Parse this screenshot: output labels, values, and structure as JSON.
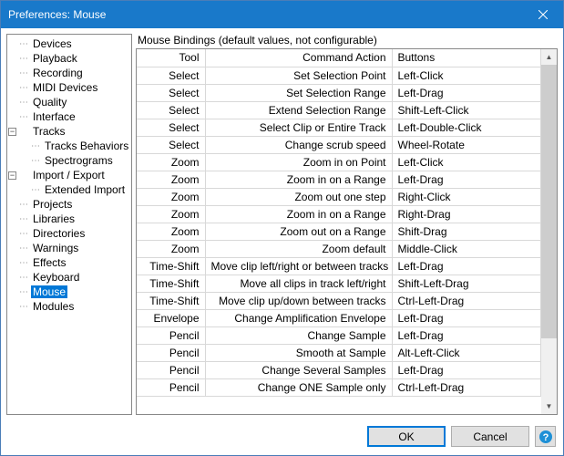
{
  "title": "Preferences: Mouse",
  "group_label": "Mouse Bindings (default values, not configurable)",
  "tree": [
    {
      "label": "Devices",
      "indent": 1,
      "glyph": "dots"
    },
    {
      "label": "Playback",
      "indent": 1,
      "glyph": "dots"
    },
    {
      "label": "Recording",
      "indent": 1,
      "glyph": "dots"
    },
    {
      "label": "MIDI Devices",
      "indent": 1,
      "glyph": "dots"
    },
    {
      "label": "Quality",
      "indent": 1,
      "glyph": "dots"
    },
    {
      "label": "Interface",
      "indent": 1,
      "glyph": "dots"
    },
    {
      "label": "Tracks",
      "indent": 0,
      "glyph": "minus"
    },
    {
      "label": "Tracks Behaviors",
      "indent": 2,
      "glyph": "dots"
    },
    {
      "label": "Spectrograms",
      "indent": 2,
      "glyph": "dots"
    },
    {
      "label": "Import / Export",
      "indent": 0,
      "glyph": "minus"
    },
    {
      "label": "Extended Import",
      "indent": 2,
      "glyph": "dots"
    },
    {
      "label": "Projects",
      "indent": 1,
      "glyph": "dots"
    },
    {
      "label": "Libraries",
      "indent": 1,
      "glyph": "dots"
    },
    {
      "label": "Directories",
      "indent": 1,
      "glyph": "dots"
    },
    {
      "label": "Warnings",
      "indent": 1,
      "glyph": "dots"
    },
    {
      "label": "Effects",
      "indent": 1,
      "glyph": "dots"
    },
    {
      "label": "Keyboard",
      "indent": 1,
      "glyph": "dots"
    },
    {
      "label": "Mouse",
      "indent": 1,
      "glyph": "dots",
      "selected": true
    },
    {
      "label": "Modules",
      "indent": 1,
      "glyph": "dots"
    }
  ],
  "columns": [
    "Tool",
    "Command Action",
    "Buttons"
  ],
  "rows": [
    [
      "Select",
      "Set Selection Point",
      "Left-Click"
    ],
    [
      "Select",
      "Set Selection Range",
      "Left-Drag"
    ],
    [
      "Select",
      "Extend Selection Range",
      "Shift-Left-Click"
    ],
    [
      "Select",
      "Select Clip or Entire Track",
      "Left-Double-Click"
    ],
    [
      "Select",
      "Change scrub speed",
      "Wheel-Rotate"
    ],
    [
      "Zoom",
      "Zoom in on Point",
      "Left-Click"
    ],
    [
      "Zoom",
      "Zoom in on a Range",
      "Left-Drag"
    ],
    [
      "Zoom",
      "Zoom out one step",
      "Right-Click"
    ],
    [
      "Zoom",
      "Zoom in on a Range",
      "Right-Drag"
    ],
    [
      "Zoom",
      "Zoom out on a Range",
      "Shift-Drag"
    ],
    [
      "Zoom",
      "Zoom default",
      "Middle-Click"
    ],
    [
      "Time-Shift",
      "Move clip left/right or between tracks",
      "Left-Drag"
    ],
    [
      "Time-Shift",
      "Move all clips in track left/right",
      "Shift-Left-Drag"
    ],
    [
      "Time-Shift",
      "Move clip up/down between tracks",
      "Ctrl-Left-Drag"
    ],
    [
      "Envelope",
      "Change Amplification Envelope",
      "Left-Drag"
    ],
    [
      "Pencil",
      "Change Sample",
      "Left-Drag"
    ],
    [
      "Pencil",
      "Smooth at Sample",
      "Alt-Left-Click"
    ],
    [
      "Pencil",
      "Change Several Samples",
      "Left-Drag"
    ],
    [
      "Pencil",
      "Change ONE Sample only",
      "Ctrl-Left-Drag"
    ]
  ],
  "buttons": {
    "ok": "OK",
    "cancel": "Cancel"
  }
}
